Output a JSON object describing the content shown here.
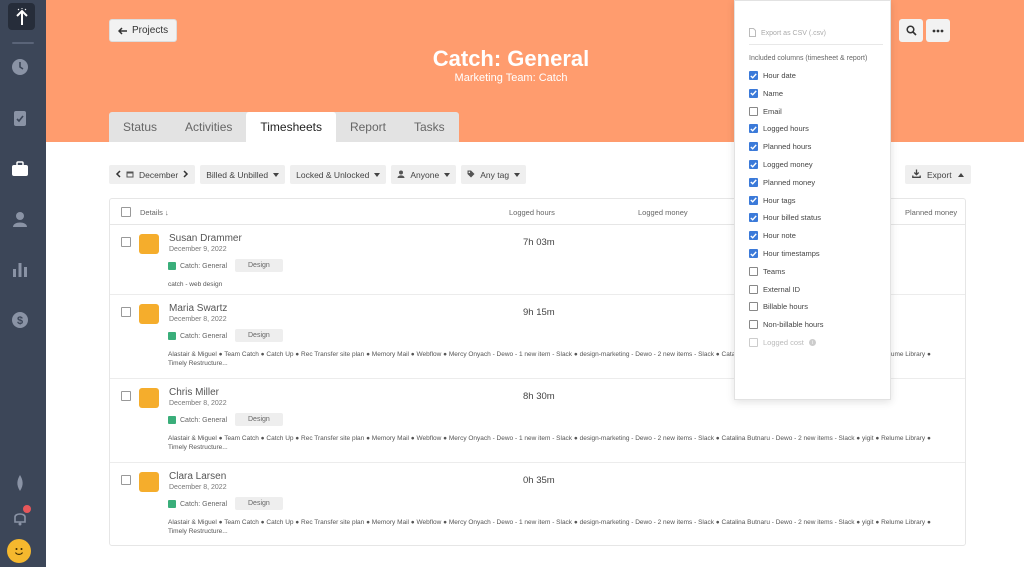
{
  "header": {
    "back_label": "Projects",
    "title": "Catch: General",
    "subtitle": "Marketing Team: Catch"
  },
  "tabs": [
    {
      "label": "Status",
      "active": false
    },
    {
      "label": "Activities",
      "active": false
    },
    {
      "label": "Timesheets",
      "active": true
    },
    {
      "label": "Report",
      "active": false
    },
    {
      "label": "Tasks",
      "active": false
    }
  ],
  "filters": {
    "month": "December",
    "billed": "Billed & Unbilled",
    "locked": "Locked & Unlocked",
    "person": "Anyone",
    "tag": "Any tag",
    "export_label": "Export"
  },
  "table": {
    "columns": {
      "details": "Details",
      "logged_hours": "Logged hours",
      "logged_money": "Logged money",
      "planned_money": "Planned money"
    },
    "rows": [
      {
        "name": "Susan Drammer",
        "date": "December 9, 2022",
        "project": "Catch: General",
        "tag": "Design",
        "hours": "7h 03m",
        "note": "catch - web design"
      },
      {
        "name": "Maria Swartz",
        "date": "December 8, 2022",
        "project": "Catch: General",
        "tag": "Design",
        "hours": "9h 15m",
        "note": "Alastair & Miguel ● Team Catch ● Catch Up ● Rec Transfer site plan ● Memory Mail ● Webflow ● Mercy Onyach - Dewo - 1 new item - Slack ● design-marketing - Dewo - 2 new items - Slack ● Catalina Butnaru - Dewo - 2 new items - Slack ● yigit ● Relume Library ● Timely Restructure..."
      },
      {
        "name": "Chris Miller",
        "date": "December 8, 2022",
        "project": "Catch: General",
        "tag": "Design",
        "hours": "8h 30m",
        "note": "Alastair & Miguel ● Team Catch ● Catch Up ● Rec Transfer site plan ● Memory Mail ● Webflow ● Mercy Onyach - Dewo - 1 new item - Slack ● design-marketing - Dewo - 2 new items - Slack ● Catalina Butnaru - Dewo - 2 new items - Slack ● yigit ● Relume Library ● Timely Restructure..."
      },
      {
        "name": "Clara Larsen",
        "date": "December 8, 2022",
        "project": "Catch: General",
        "tag": "Design",
        "hours": "0h 35m",
        "note": "Alastair & Miguel ● Team Catch ● Catch Up ● Rec Transfer site plan ● Memory Mail ● Webflow ● Mercy Onyach - Dewo - 1 new item - Slack ● design-marketing - Dewo - 2 new items - Slack ● Catalina Butnaru - Dewo - 2 new items - Slack ● yigit ● Relume Library ● Timely Restructure..."
      }
    ]
  },
  "export_menu": {
    "csv_label": "Export as CSV (.csv)",
    "section_title": "Included columns (timesheet & report)",
    "items": [
      {
        "label": "Hour date",
        "checked": true
      },
      {
        "label": "Name",
        "checked": true
      },
      {
        "label": "Email",
        "checked": false
      },
      {
        "label": "Logged hours",
        "checked": true
      },
      {
        "label": "Planned hours",
        "checked": true
      },
      {
        "label": "Logged money",
        "checked": true
      },
      {
        "label": "Planned money",
        "checked": true
      },
      {
        "label": "Hour tags",
        "checked": true
      },
      {
        "label": "Hour billed status",
        "checked": true
      },
      {
        "label": "Hour note",
        "checked": true
      },
      {
        "label": "Hour timestamps",
        "checked": true
      },
      {
        "label": "Teams",
        "checked": false
      },
      {
        "label": "External ID",
        "checked": false
      },
      {
        "label": "Billable hours",
        "checked": false
      },
      {
        "label": "Non-billable hours",
        "checked": false
      },
      {
        "label": "Logged cost",
        "checked": false
      }
    ]
  },
  "colors": {
    "header": "#ff9c6e",
    "rail": "#3c4658",
    "checkbox_on": "#3b7ad9",
    "avatar": "#f5ad2c",
    "project_dot": "#3aae7a"
  }
}
